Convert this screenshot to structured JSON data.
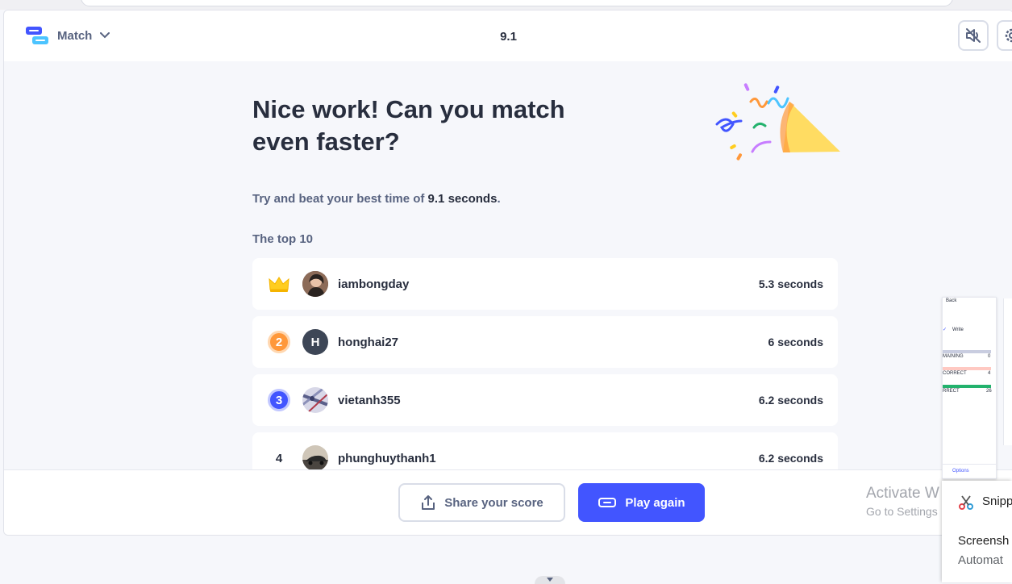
{
  "header": {
    "mode_label": "Match",
    "timer": "9.1",
    "mute_icon": "speaker-muted-icon",
    "settings_icon": "gear-icon"
  },
  "main": {
    "headline": "Nice work! Can you match even faster?",
    "subtitle_prefix": "Try and beat your best time of ",
    "subtitle_best": "9.1 seconds",
    "subtitle_suffix": ".",
    "leaderboard_title": "The top 10"
  },
  "leaderboard": [
    {
      "rank": "1",
      "rank_icon": "crown-icon",
      "avatar_initial": "",
      "username": "iambongday",
      "time": "5.3 seconds"
    },
    {
      "rank": "2",
      "rank_icon": "medal-silver",
      "avatar_initial": "H",
      "username": "honghai27",
      "time": "6 seconds"
    },
    {
      "rank": "3",
      "rank_icon": "medal-bronze",
      "avatar_initial": "",
      "username": "vietanh355",
      "time": "6.2 seconds"
    },
    {
      "rank": "4",
      "rank_icon": "",
      "avatar_initial": "",
      "username": "phunghuythanh1",
      "time": "6.2 seconds"
    }
  ],
  "footer": {
    "share_label": "Share your score",
    "play_label": "Play again"
  },
  "overlay": {
    "activate_line1": "Activate W",
    "activate_line2": "Go to Settings",
    "thumbnail": {
      "back": "Back",
      "write": "Write",
      "remaining": "MAINING",
      "remaining_count": "0",
      "incorrect": "CORRECT",
      "incorrect_count": "4",
      "correct": "RRECT",
      "correct_count": "26",
      "options": "Options"
    },
    "snip_title": "Snipp",
    "snip_line1": "Screensh",
    "snip_line2": "Automat"
  },
  "colors": {
    "accent": "#4255ff",
    "text": "#282e3e",
    "muted": "#586380",
    "background": "#f6f7fb",
    "medal_2": "#ff983a",
    "medal_3": "#4255ff",
    "crown": "#ffcd1f"
  }
}
